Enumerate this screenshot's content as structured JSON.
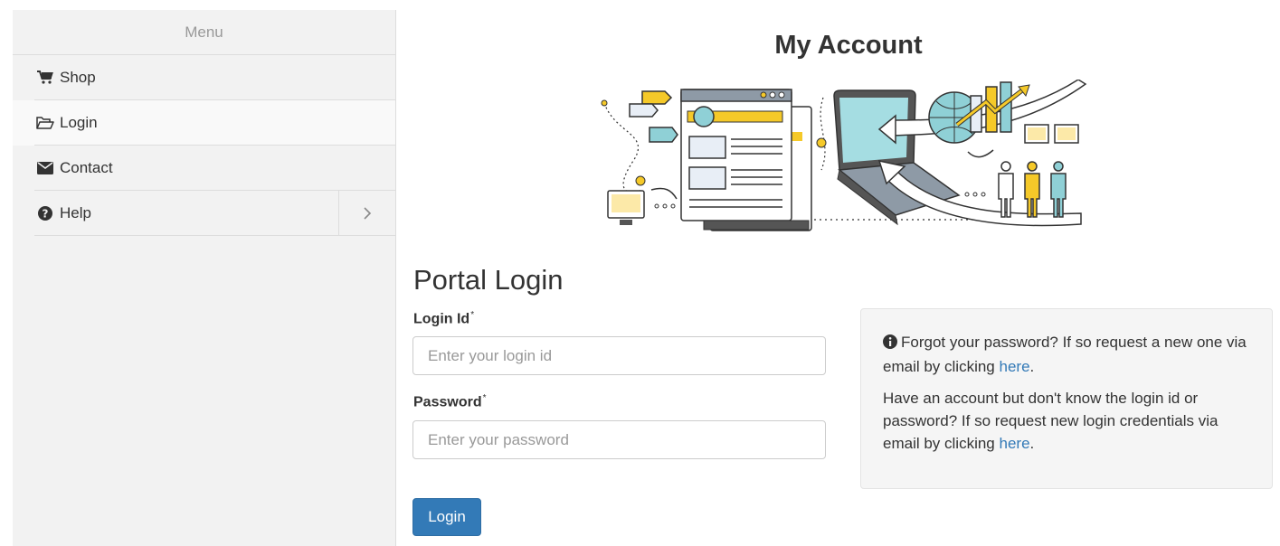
{
  "sidebar": {
    "header": "Menu",
    "items": [
      {
        "label": "Shop",
        "icon": "shopping-cart-icon"
      },
      {
        "label": "Login",
        "icon": "folder-open-icon"
      },
      {
        "label": "Contact",
        "icon": "envelope-icon"
      },
      {
        "label": "Help",
        "icon": "question-circle-icon",
        "has_submenu": true
      }
    ]
  },
  "main": {
    "title": "My Account",
    "section_title": "Portal Login",
    "login_id": {
      "label": "Login Id",
      "required_marker": "*",
      "placeholder": "Enter your login id",
      "value": ""
    },
    "password": {
      "label": "Password",
      "required_marker": "*",
      "placeholder": "Enter your password",
      "value": ""
    },
    "login_button": "Login"
  },
  "info": {
    "icon": "info-circle-icon",
    "forgot_text": "Forgot your password? If so request a new one via email by clicking",
    "forgot_link": "here",
    "credentials_text": "Have an account but don't know the login id or password? If so request new login credentials via email by clicking",
    "credentials_link": "here",
    "period": "."
  },
  "colors": {
    "sidebar_bg": "#f2f2f2",
    "primary": "#337ab7",
    "info_bg": "#f5f5f5",
    "illustration_yellow": "#f5c929",
    "illustration_teal": "#8fd0d6"
  }
}
